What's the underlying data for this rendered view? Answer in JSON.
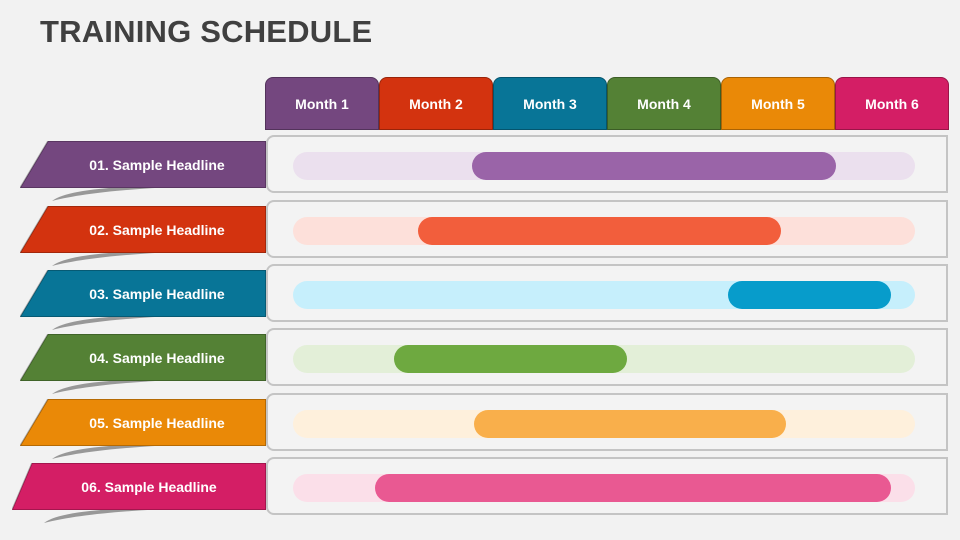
{
  "title": "TRAINING SCHEDULE",
  "months": [
    {
      "label": "Month 1",
      "color": "#74477f"
    },
    {
      "label": "Month 2",
      "color": "#d3330f"
    },
    {
      "label": "Month 3",
      "color": "#087597"
    },
    {
      "label": "Month 4",
      "color": "#548135"
    },
    {
      "label": "Month 5",
      "color": "#ea8907"
    },
    {
      "label": "Month 6",
      "color": "#d41e65"
    }
  ],
  "rows": [
    {
      "label": "01. Sample Headline",
      "color": "#74477f",
      "bar_color": "#9a64a8",
      "track_color": "#ebe0ee",
      "start_fraction": 0.288,
      "end_fraction": 0.873
    },
    {
      "label": "02. Sample Headline",
      "color": "#d3330f",
      "bar_color": "#f25e3c",
      "track_color": "#fde0da",
      "start_fraction": 0.201,
      "end_fraction": 0.785
    },
    {
      "label": "03. Sample Headline",
      "color": "#087597",
      "bar_color": "#079ccb",
      "track_color": "#c6effc",
      "start_fraction": 0.699,
      "end_fraction": 0.961
    },
    {
      "label": "04. Sample Headline",
      "color": "#548135",
      "bar_color": "#6ea940",
      "track_color": "#e3efd8",
      "start_fraction": 0.162,
      "end_fraction": 0.537
    },
    {
      "label": "05. Sample Headline",
      "color": "#ea8907",
      "bar_color": "#f9af4b",
      "track_color": "#fef0dc",
      "start_fraction": 0.291,
      "end_fraction": 0.793
    },
    {
      "label": "06. Sample Headline",
      "color": "#d41e65",
      "bar_color": "#e95992",
      "track_color": "#fbdfe9",
      "start_fraction": 0.132,
      "end_fraction": 0.961
    }
  ]
}
